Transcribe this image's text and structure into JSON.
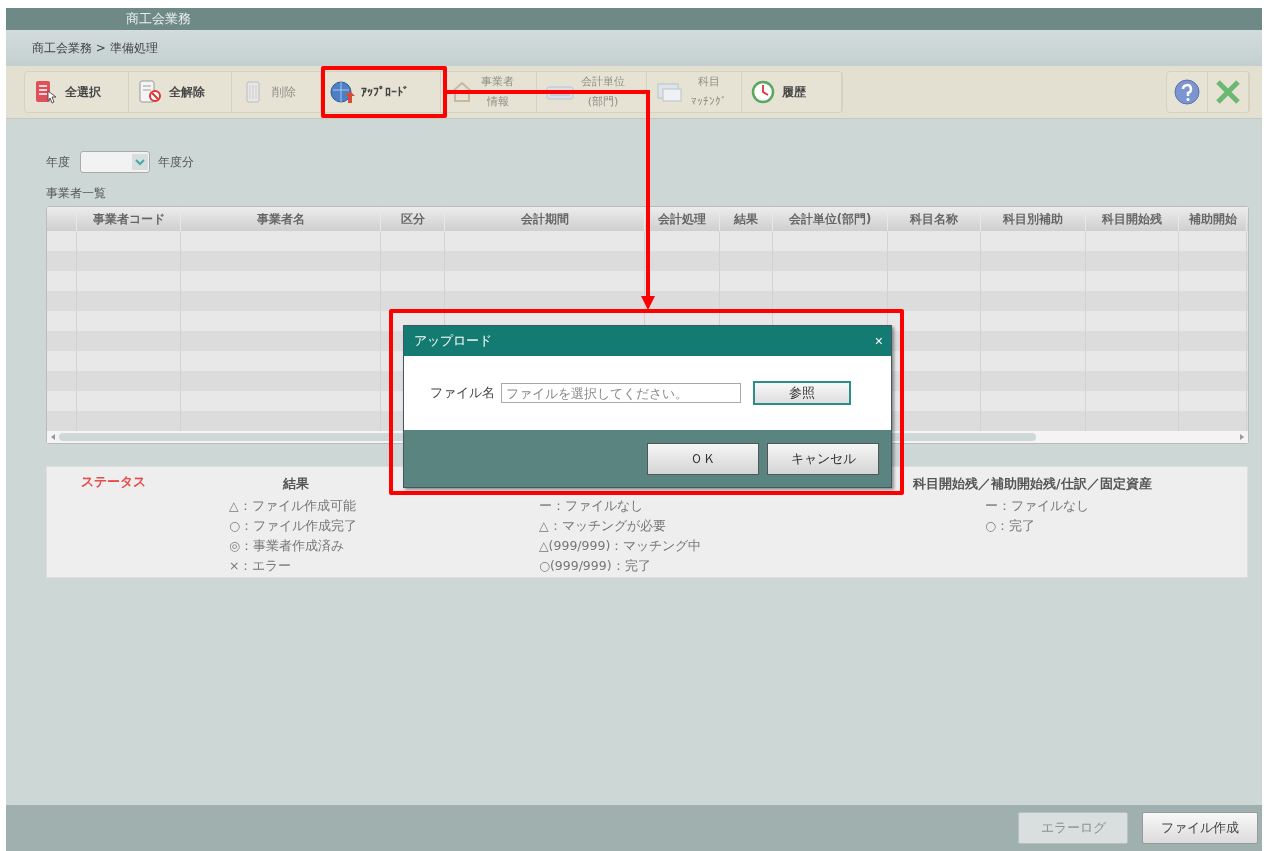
{
  "window": {
    "title": "商工会業務"
  },
  "breadcrumb": "商工会業務 > 準備処理",
  "toolbar": [
    {
      "label": "全選択",
      "disabled": false
    },
    {
      "label": "全解除",
      "disabled": false
    },
    {
      "label": "削除",
      "disabled": true
    },
    {
      "label": "ｱｯﾌﾟﾛｰﾄﾞ",
      "disabled": false
    },
    {
      "lines": [
        "事業者",
        "情報"
      ],
      "disabled": true
    },
    {
      "lines": [
        "会計単位",
        "(部門)"
      ],
      "disabled": true
    },
    {
      "lines": [
        "科目",
        "ﾏｯﾁﾝｸﾞ"
      ],
      "disabled": true
    },
    {
      "label": "履歴",
      "disabled": false
    }
  ],
  "year": {
    "label": "年度",
    "suffix": "年度分"
  },
  "list_title": "事業者一覧",
  "table": {
    "columns": [
      "",
      "事業者コード",
      "事業者名",
      "区分",
      "会計期間",
      "会計処理",
      "結果",
      "会計単位(部門)",
      "科目名称",
      "科目別補助",
      "科目開始残",
      "補助開始"
    ]
  },
  "legend": {
    "status_label": "ステータス",
    "groups": [
      {
        "title": "結果",
        "items": [
          "△：ファイル作成可能",
          "○：ファイル作成完了",
          "◎：事業者作成済み",
          "×：エラー"
        ]
      },
      {
        "items": [
          "ー：ファイルなし",
          "△：マッチングが必要",
          "△(999/999)：マッチング中",
          "○(999/999)：完了"
        ]
      },
      {
        "title": "科目開始残／補助開始残/仕訳／固定資産",
        "items": [
          "ー：ファイルなし",
          "○：完了"
        ]
      }
    ]
  },
  "dialog": {
    "title": "アップロード",
    "close": "×",
    "field_label": "ファイル名",
    "placeholder": "ファイルを選択してください。",
    "browse": "参照",
    "ok": "ＯＫ",
    "cancel": "キャンセル"
  },
  "footer": [
    {
      "label": "エラーログ",
      "disabled": true
    },
    {
      "label": "ファイル作成",
      "disabled": false
    }
  ]
}
